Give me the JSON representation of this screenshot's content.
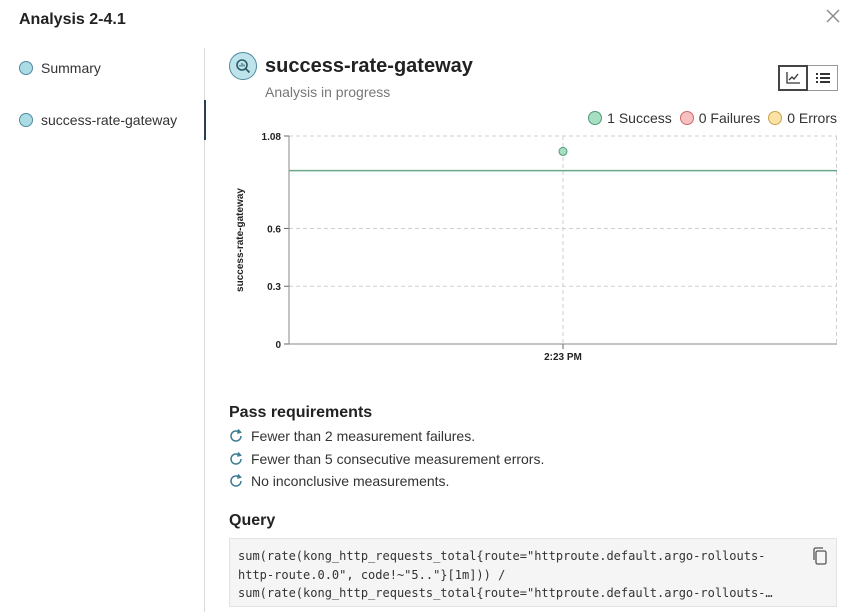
{
  "modal": {
    "title": "Analysis 2-4.1"
  },
  "sidebar": {
    "items": [
      {
        "label": "Summary",
        "active": false
      },
      {
        "label": "success-rate-gateway",
        "active": true
      }
    ]
  },
  "metric": {
    "title": "success-rate-gateway",
    "status": "Analysis in progress",
    "view_toggle": [
      "chart-view",
      "list-view"
    ]
  },
  "legend": {
    "success": "1 Success",
    "failures": "0 Failures",
    "errors": "0 Errors",
    "colors": {
      "success": "#a8dfc3",
      "failures": "#f7c1c1",
      "errors": "#fbe3a6"
    }
  },
  "chart_data": {
    "type": "scatter",
    "ylabel": "success-rate-gateway",
    "xlabel": "",
    "ylim": [
      0,
      1.08
    ],
    "yticks": [
      {
        "value": 1.08,
        "label": "1.08"
      },
      {
        "value": 0.6,
        "label": "0.6"
      },
      {
        "value": 0.3,
        "label": "0.3"
      },
      {
        "value": 0,
        "label": "0"
      }
    ],
    "xticks": [
      "2:23 PM"
    ],
    "threshold": 0.9,
    "series": [
      {
        "points": [
          {
            "x": "2:23 PM",
            "y": 1.0
          }
        ],
        "color": "#a8dfc3"
      }
    ],
    "grid": true
  },
  "pass_requirements": {
    "title": "Pass requirements",
    "items": [
      "Fewer than 2 measurement failures.",
      "Fewer than 5 consecutive measurement errors.",
      "No inconclusive measurements."
    ]
  },
  "query": {
    "title": "Query",
    "lines": [
      "sum(rate(kong_http_requests_total{route=\"httproute.default.argo-rollouts-",
      "http-route.0.0\", code!~\"5..\"}[1m])) /",
      "sum(rate(kong_http_requests_total{route=\"httproute.default.argo-rollouts-…"
    ]
  }
}
